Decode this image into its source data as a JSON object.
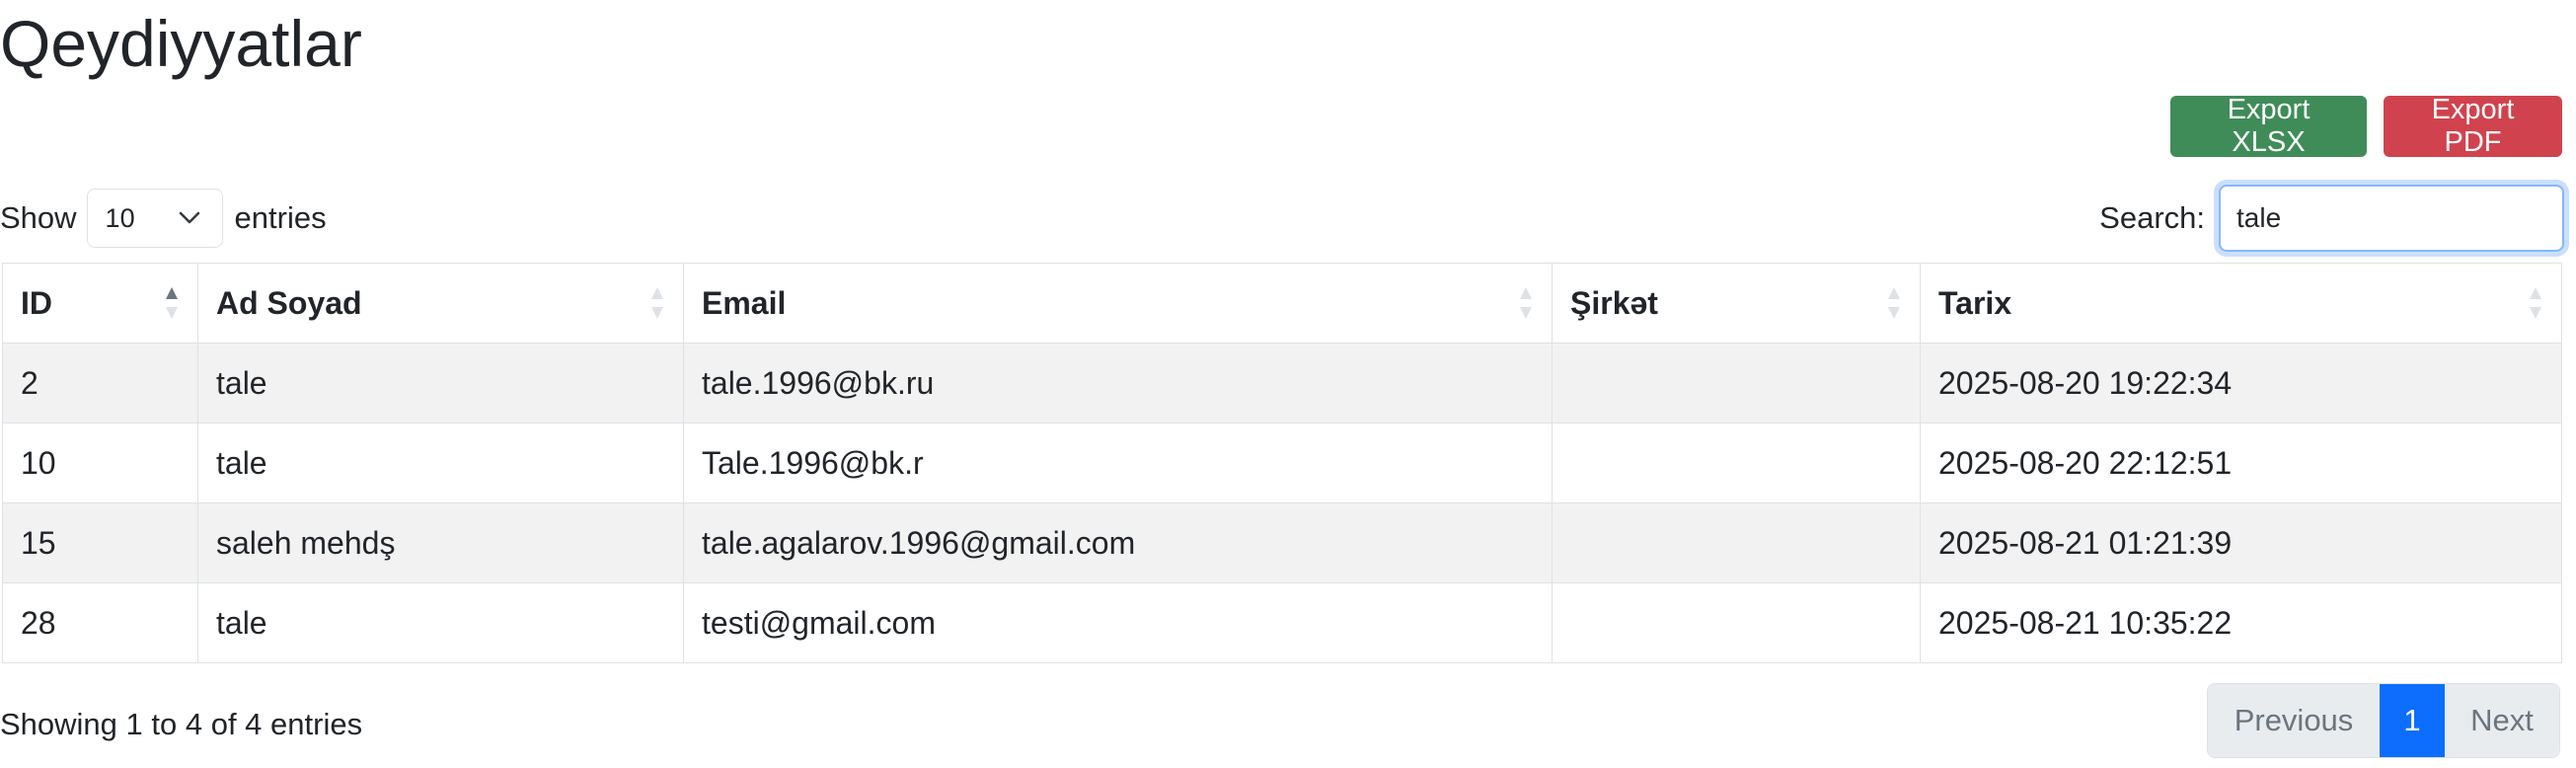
{
  "page": {
    "title": "Qeydiyyatlar"
  },
  "toolbar": {
    "export_xlsx_label": "Export XLSX",
    "export_pdf_label": "Export PDF",
    "colors": {
      "xlsx": "#3f8c59",
      "pdf": "#d0434e"
    }
  },
  "length": {
    "show_label": "Show",
    "selected": "10",
    "entries_label": "entries"
  },
  "search": {
    "label": "Search:",
    "value": "tale"
  },
  "table": {
    "headers": [
      "ID",
      "Ad Soyad",
      "Email",
      "Şirkət",
      "Tarix"
    ],
    "sorted_column": "ID",
    "sort_direction": "asc",
    "rows": [
      {
        "id": "2",
        "name": "tale",
        "email": "tale.1996@bk.ru",
        "company": "",
        "date": "2025-08-20 19:22:34"
      },
      {
        "id": "10",
        "name": "tale",
        "email": "Tale.1996@bk.r",
        "company": "",
        "date": "2025-08-20 22:12:51"
      },
      {
        "id": "15",
        "name": "saleh mehdş",
        "email": "tale.agalarov.1996@gmail.com",
        "company": "",
        "date": "2025-08-21 01:21:39"
      },
      {
        "id": "28",
        "name": "tale",
        "email": "testi@gmail.com",
        "company": "",
        "date": "2025-08-21 10:35:22"
      }
    ]
  },
  "info": {
    "text": "Showing 1 to 4 of 4 entries"
  },
  "pagination": {
    "previous": "Previous",
    "current_page": "1",
    "next": "Next",
    "active_color": "#0d6efd"
  }
}
